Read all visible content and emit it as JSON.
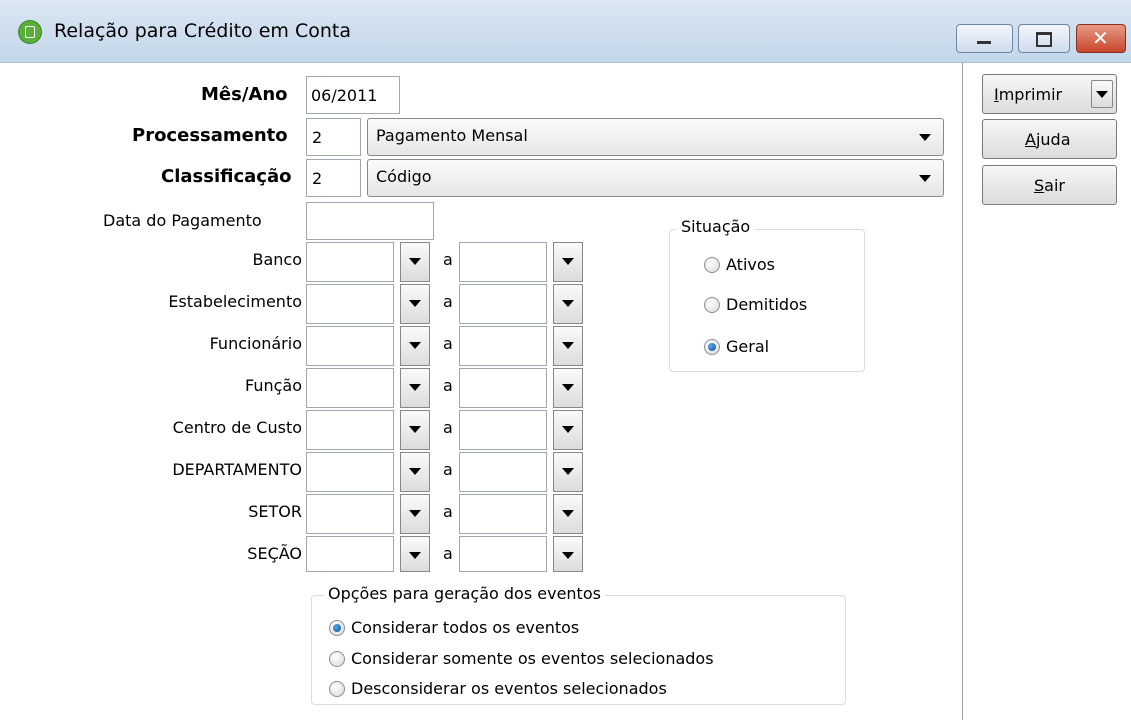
{
  "window": {
    "title": "Relação para Crédito em Conta"
  },
  "form": {
    "mes_ano": {
      "label": "Mês/Ano",
      "value": "06/2011"
    },
    "processamento": {
      "label": "Processamento",
      "code": "2",
      "selected": "Pagamento Mensal"
    },
    "classificacao": {
      "label": "Classificação",
      "code": "2",
      "selected": "Código"
    },
    "data_pagamento": {
      "label": "Data do Pagamento",
      "value": ""
    },
    "ranges": [
      {
        "label": "Banco",
        "sep": "a"
      },
      {
        "label": "Estabelecimento",
        "sep": "a"
      },
      {
        "label": "Funcionário",
        "sep": "a"
      },
      {
        "label": "Função",
        "sep": "a"
      },
      {
        "label": "Centro de Custo",
        "sep": "a"
      },
      {
        "label": "DEPARTAMENTO",
        "sep": "a"
      },
      {
        "label": "SETOR",
        "sep": "a"
      },
      {
        "label": "SEÇÃO",
        "sep": "a"
      }
    ]
  },
  "situacao": {
    "title": "Situação",
    "options": [
      "Ativos",
      "Demitidos",
      "Geral"
    ],
    "selected": "Geral"
  },
  "opcoes": {
    "title": "Opções para geração dos eventos",
    "options": [
      "Considerar todos os eventos",
      "Considerar somente os eventos selecionados",
      "Desconsiderar os eventos selecionados"
    ],
    "selected": "Considerar todos os eventos"
  },
  "buttons": {
    "imprimir": {
      "first": "I",
      "rest": "mprimir"
    },
    "ajuda": {
      "first": "A",
      "rest": "juda"
    },
    "sair": {
      "first": "S",
      "rest": "air"
    }
  },
  "colors": {
    "title_gradient_top": "#dbe7f3",
    "close_button": "#c9462d",
    "radio_selected": "#0c4f9a"
  }
}
